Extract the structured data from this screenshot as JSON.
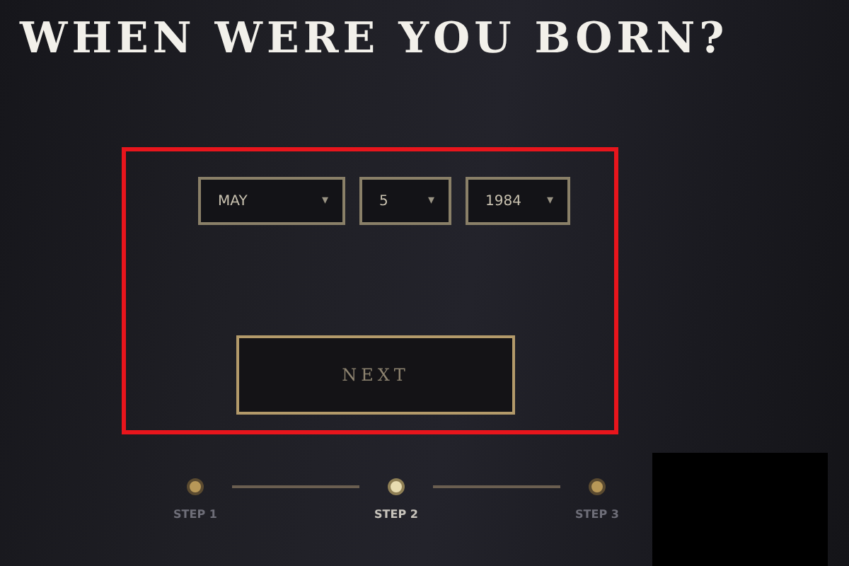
{
  "heading": "WHEN WERE YOU BORN?",
  "dropdowns": [
    {
      "value": "MAY",
      "caret": "▾"
    },
    {
      "value": "5",
      "caret": "▾"
    },
    {
      "value": "1984",
      "caret": "▾"
    }
  ],
  "next_button": {
    "label": "NEXT"
  },
  "steps": [
    {
      "label": "STEP 1",
      "selected": false
    },
    {
      "label": "STEP 2",
      "selected": true
    },
    {
      "label": "STEP 3",
      "selected": false
    }
  ]
}
